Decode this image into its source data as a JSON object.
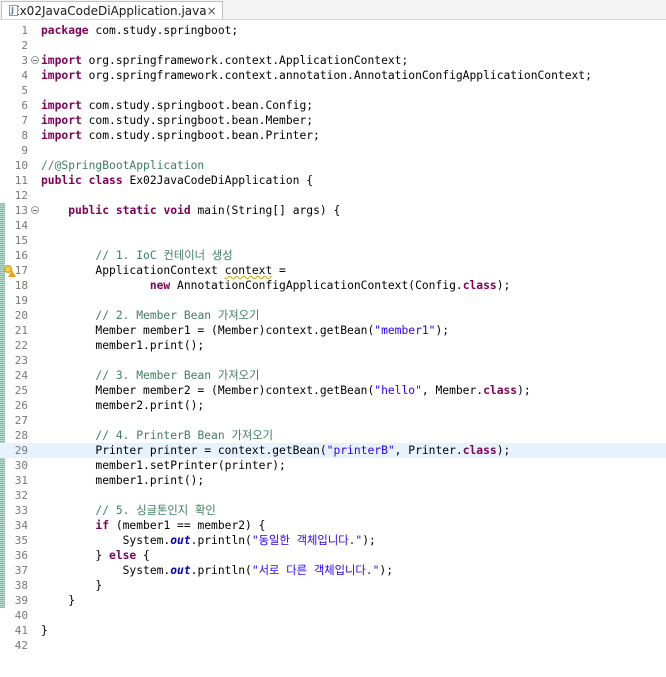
{
  "tab": {
    "filename": "Ex02JavaCodeDiApplication.java",
    "close_glyph": "×",
    "icon": "java-file-icon"
  },
  "editor": {
    "current_line": 29,
    "lines": [
      {
        "n": "1",
        "tokens": [
          {
            "t": "package",
            "c": "kw"
          },
          {
            "t": " com.study.springboot;"
          }
        ]
      },
      {
        "n": "2",
        "tokens": []
      },
      {
        "n": "3",
        "fold": true,
        "tokens": [
          {
            "t": "import",
            "c": "kw"
          },
          {
            "t": " org.springframework.context.ApplicationContext;"
          }
        ]
      },
      {
        "n": "4",
        "tokens": [
          {
            "t": "import",
            "c": "kw"
          },
          {
            "t": " org.springframework.context.annotation.AnnotationConfigApplicationContext;"
          }
        ]
      },
      {
        "n": "5",
        "tokens": []
      },
      {
        "n": "6",
        "tokens": [
          {
            "t": "import",
            "c": "kw"
          },
          {
            "t": " com.study.springboot.bean.Config;"
          }
        ]
      },
      {
        "n": "7",
        "tokens": [
          {
            "t": "import",
            "c": "kw"
          },
          {
            "t": " com.study.springboot.bean.Member;"
          }
        ]
      },
      {
        "n": "8",
        "tokens": [
          {
            "t": "import",
            "c": "kw"
          },
          {
            "t": " com.study.springboot.bean.Printer;"
          }
        ]
      },
      {
        "n": "9",
        "tokens": []
      },
      {
        "n": "10",
        "tokens": [
          {
            "t": "//@SpringBootApplication",
            "c": "cm"
          }
        ]
      },
      {
        "n": "11",
        "tokens": [
          {
            "t": "public",
            "c": "kw"
          },
          {
            "t": " "
          },
          {
            "t": "class",
            "c": "kw"
          },
          {
            "t": " Ex02JavaCodeDiApplication {"
          }
        ]
      },
      {
        "n": "12",
        "tokens": []
      },
      {
        "n": "13",
        "fold": true,
        "tokens": [
          {
            "t": "    "
          },
          {
            "t": "public",
            "c": "kw"
          },
          {
            "t": " "
          },
          {
            "t": "static",
            "c": "kw"
          },
          {
            "t": " "
          },
          {
            "t": "void",
            "c": "kw"
          },
          {
            "t": " main(String[] args) {"
          }
        ]
      },
      {
        "n": "14",
        "tokens": []
      },
      {
        "n": "15",
        "tokens": []
      },
      {
        "n": "16",
        "tokens": [
          {
            "t": "        "
          },
          {
            "t": "// 1. IoC 컨테이너 생성",
            "c": "cm"
          }
        ]
      },
      {
        "n": "17",
        "marker": true,
        "tokens": [
          {
            "t": "        ApplicationContext "
          },
          {
            "t": "context",
            "c": "squig"
          },
          {
            "t": " ="
          }
        ]
      },
      {
        "n": "18",
        "tokens": [
          {
            "t": "                "
          },
          {
            "t": "new",
            "c": "kw"
          },
          {
            "t": " AnnotationConfigApplicationContext(Config."
          },
          {
            "t": "class",
            "c": "kw"
          },
          {
            "t": ");"
          }
        ]
      },
      {
        "n": "19",
        "tokens": []
      },
      {
        "n": "20",
        "tokens": [
          {
            "t": "        "
          },
          {
            "t": "// 2. Member Bean 가져오기",
            "c": "cm"
          }
        ]
      },
      {
        "n": "21",
        "tokens": [
          {
            "t": "        Member member1 = (Member)context.getBean("
          },
          {
            "t": "\"member1\"",
            "c": "str"
          },
          {
            "t": ");"
          }
        ]
      },
      {
        "n": "22",
        "tokens": [
          {
            "t": "        member1.print();"
          }
        ]
      },
      {
        "n": "23",
        "tokens": []
      },
      {
        "n": "24",
        "tokens": [
          {
            "t": "        "
          },
          {
            "t": "// 3. Member Bean 가져오기",
            "c": "cm"
          }
        ]
      },
      {
        "n": "25",
        "tokens": [
          {
            "t": "        Member member2 = (Member)context.getBean("
          },
          {
            "t": "\"hello\"",
            "c": "str"
          },
          {
            "t": ", Member."
          },
          {
            "t": "class",
            "c": "kw"
          },
          {
            "t": ");"
          }
        ]
      },
      {
        "n": "26",
        "tokens": [
          {
            "t": "        member2.print();"
          }
        ]
      },
      {
        "n": "27",
        "tokens": []
      },
      {
        "n": "28",
        "tokens": [
          {
            "t": "        "
          },
          {
            "t": "// 4. PrinterB Bean 가져오기",
            "c": "cm"
          }
        ]
      },
      {
        "n": "29",
        "tokens": [
          {
            "t": "        Printer printer = context.getBean("
          },
          {
            "t": "\"printerB\"",
            "c": "str"
          },
          {
            "t": ", Printer."
          },
          {
            "t": "class",
            "c": "kw"
          },
          {
            "t": ");"
          }
        ]
      },
      {
        "n": "30",
        "tokens": [
          {
            "t": "        member1.setPrinter(printer);"
          }
        ]
      },
      {
        "n": "31",
        "tokens": [
          {
            "t": "        member1.print();"
          }
        ]
      },
      {
        "n": "32",
        "tokens": []
      },
      {
        "n": "33",
        "tokens": [
          {
            "t": "        "
          },
          {
            "t": "// 5. 싱글톤인지 확인",
            "c": "cm"
          }
        ]
      },
      {
        "n": "34",
        "tokens": [
          {
            "t": "        "
          },
          {
            "t": "if",
            "c": "kw"
          },
          {
            "t": " (member1 == member2) {"
          }
        ]
      },
      {
        "n": "35",
        "tokens": [
          {
            "t": "            System."
          },
          {
            "t": "out",
            "c": "sfld"
          },
          {
            "t": ".println("
          },
          {
            "t": "\"동일한 객체입니다.\"",
            "c": "str"
          },
          {
            "t": ");"
          }
        ]
      },
      {
        "n": "36",
        "tokens": [
          {
            "t": "        } "
          },
          {
            "t": "else",
            "c": "kw"
          },
          {
            "t": " {"
          }
        ]
      },
      {
        "n": "37",
        "tokens": [
          {
            "t": "            System."
          },
          {
            "t": "out",
            "c": "sfld"
          },
          {
            "t": ".println("
          },
          {
            "t": "\"서로 다른 객체입니다.\"",
            "c": "str"
          },
          {
            "t": ");"
          }
        ]
      },
      {
        "n": "38",
        "tokens": [
          {
            "t": "        }"
          }
        ]
      },
      {
        "n": "39",
        "tokens": [
          {
            "t": "    }"
          }
        ]
      },
      {
        "n": "40",
        "tokens": []
      },
      {
        "n": "41",
        "tokens": [
          {
            "t": "}"
          }
        ]
      },
      {
        "n": "42",
        "tokens": []
      }
    ]
  }
}
